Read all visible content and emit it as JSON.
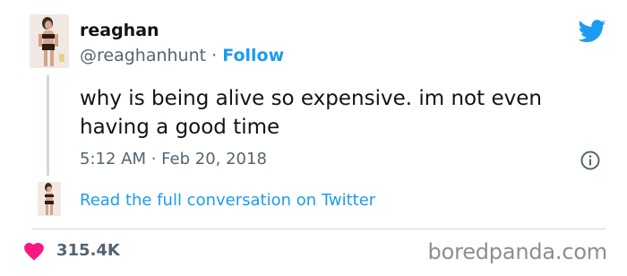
{
  "author": {
    "name": "reaghan",
    "handle": "@reaghanhunt",
    "separator": "·",
    "follow_label": "Follow"
  },
  "tweet": {
    "text": "why is being alive so expensive. im not even having a good time",
    "timestamp": "5:12 AM · Feb 20, 2018"
  },
  "conversation": {
    "link_label": "Read the full conversation on Twitter"
  },
  "engagement": {
    "like_count": "315.4K"
  },
  "watermark": "boredpanda.com",
  "icons": {
    "brand": "twitter-bird-icon",
    "info": "info-icon",
    "like": "heart-icon"
  },
  "colors": {
    "twitter_blue": "#1d9bf0",
    "heart": "#f91880",
    "text": "#0f1419",
    "muted": "#536471",
    "divider": "#cfd9de"
  }
}
